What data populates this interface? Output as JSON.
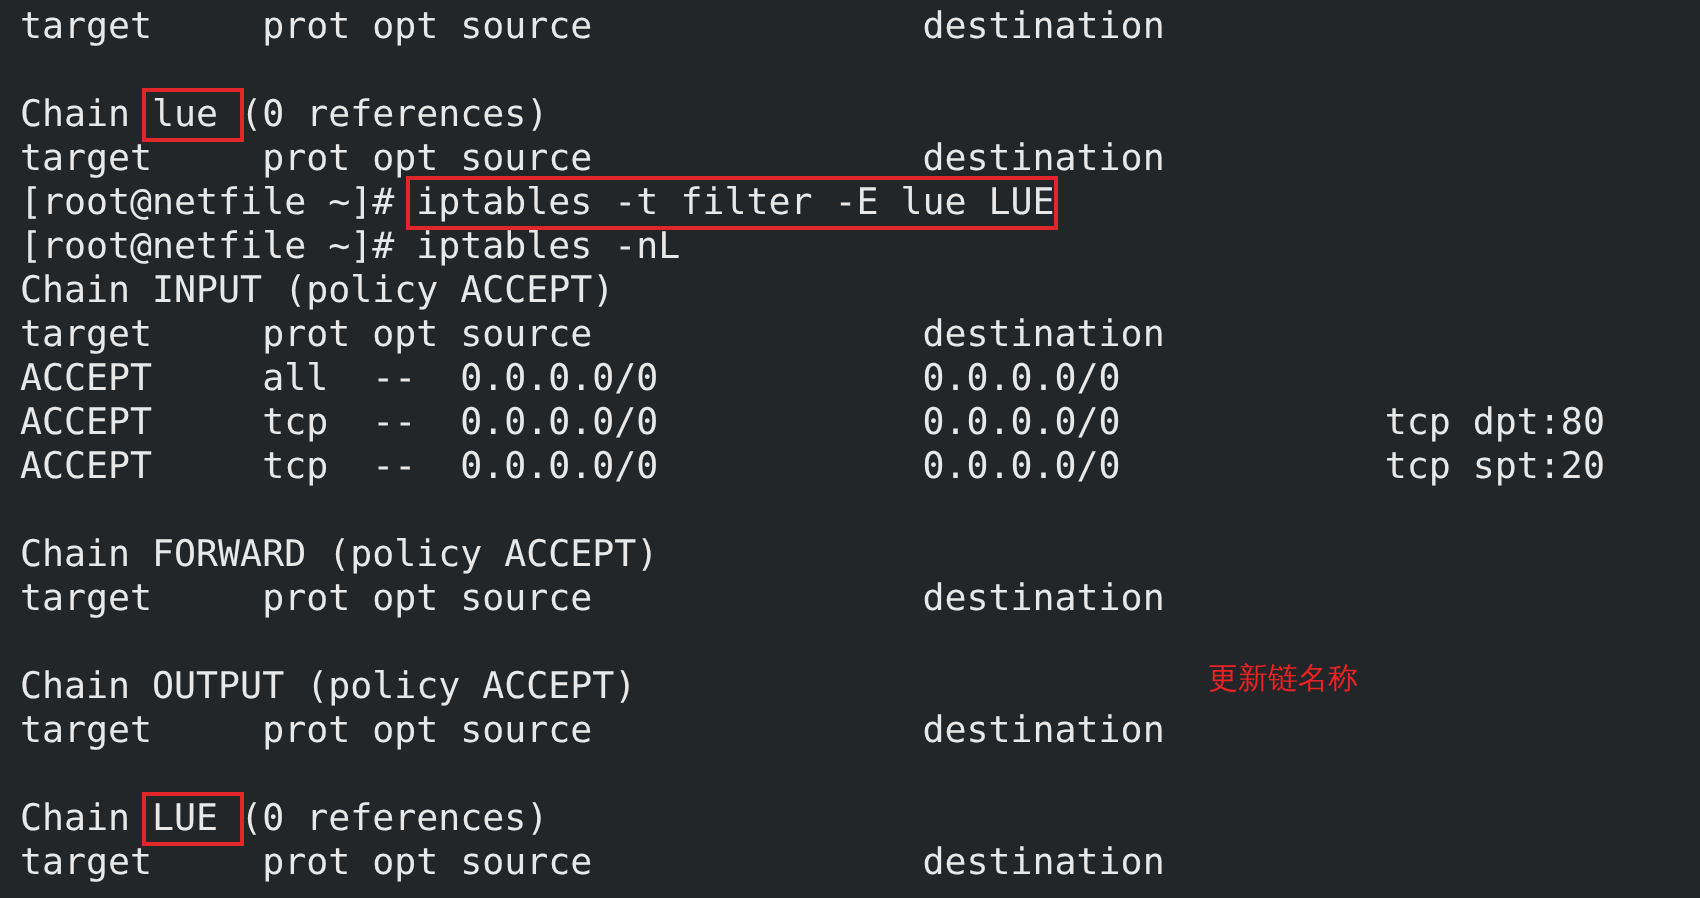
{
  "terminal": {
    "blocks": [
      {
        "lines": [
          {
            "segments": [
              {
                "text": "target     prot opt source               destination"
              }
            ]
          }
        ]
      },
      {
        "lines": [
          {
            "segments": [
              {
                "text": "Chain "
              },
              {
                "text": "lue ",
                "highlighted": true
              },
              {
                "text": "(0 references)"
              }
            ]
          },
          {
            "segments": [
              {
                "text": "target     prot opt source               destination"
              }
            ]
          },
          {
            "segments": [
              {
                "text": "[root@netfile ~]# "
              },
              {
                "text": "iptables -t filter -E lue LUE",
                "highlighted": true
              }
            ]
          },
          {
            "segments": [
              {
                "text": "[root@netfile ~]# iptables -nL"
              }
            ]
          },
          {
            "segments": [
              {
                "text": "Chain INPUT (policy ACCEPT)"
              }
            ]
          },
          {
            "segments": [
              {
                "text": "target     prot opt source               destination"
              }
            ]
          },
          {
            "segments": [
              {
                "text": "ACCEPT     all  --  0.0.0.0/0            0.0.0.0/0"
              }
            ]
          },
          {
            "segments": [
              {
                "text": "ACCEPT     tcp  --  0.0.0.0/0            0.0.0.0/0            tcp dpt:80"
              }
            ]
          },
          {
            "segments": [
              {
                "text": "ACCEPT     tcp  --  0.0.0.0/0            0.0.0.0/0            tcp spt:20"
              }
            ]
          }
        ]
      },
      {
        "lines": [
          {
            "segments": [
              {
                "text": "Chain FORWARD (policy ACCEPT)"
              }
            ]
          },
          {
            "segments": [
              {
                "text": "target     prot opt source               destination"
              }
            ]
          }
        ]
      },
      {
        "lines": [
          {
            "segments": [
              {
                "text": "Chain OUTPUT (policy ACCEPT)"
              }
            ],
            "note": "更新链名称"
          },
          {
            "segments": [
              {
                "text": "target     prot opt source               destination"
              }
            ]
          }
        ]
      },
      {
        "lines": [
          {
            "segments": [
              {
                "text": "Chain "
              },
              {
                "text": "LUE ",
                "highlighted": true
              },
              {
                "text": "(0 references)"
              }
            ]
          },
          {
            "segments": [
              {
                "text": "target     prot opt source               destination"
              }
            ]
          }
        ]
      }
    ]
  }
}
